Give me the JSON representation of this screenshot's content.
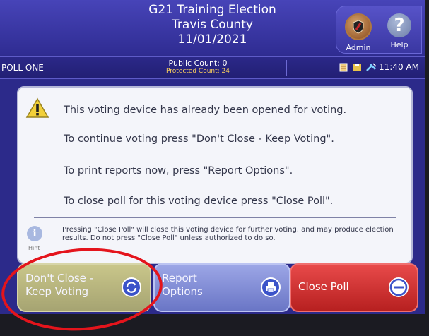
{
  "header": {
    "title_line1": "G21 Training Election",
    "title_line2": "Travis County",
    "title_line3": "11/01/2021",
    "admin_label": "Admin",
    "help_label": "Help"
  },
  "statusbar": {
    "poll_name": "POLL ONE",
    "public_count": "Public Count: 0",
    "protected_count": "Protected Count: 24",
    "time": "11:40 AM"
  },
  "message": {
    "line1": "This voting device has already been opened for voting.",
    "line2": "To continue voting press \"Don't Close - Keep Voting\".",
    "line3": "To print reports now, press \"Report Options\".",
    "line4": "To close poll for this voting device press \"Close Poll\".",
    "hint_label": "Hint",
    "note": "Pressing \"Close Poll\" will close this voting device for further voting, and may produce election results.  Do not press \"Close Poll\" unless authorized to do so."
  },
  "buttons": {
    "keep_voting_line1": "Don't Close -",
    "keep_voting_line2": "Keep Voting",
    "report_line1": "Report",
    "report_line2": "Options",
    "close_poll": "Close Poll"
  },
  "icons": {
    "admin": "shield-icon",
    "help": "question-icon",
    "warning": "warning-icon",
    "info": "info-icon",
    "refresh": "refresh-icon",
    "printer": "printer-icon",
    "close": "minus-circle-icon"
  },
  "colors": {
    "keep_voting": "#b8b67e",
    "report_options": "#8590d8",
    "close_poll": "#d33030",
    "annotation": "#e4141c"
  }
}
